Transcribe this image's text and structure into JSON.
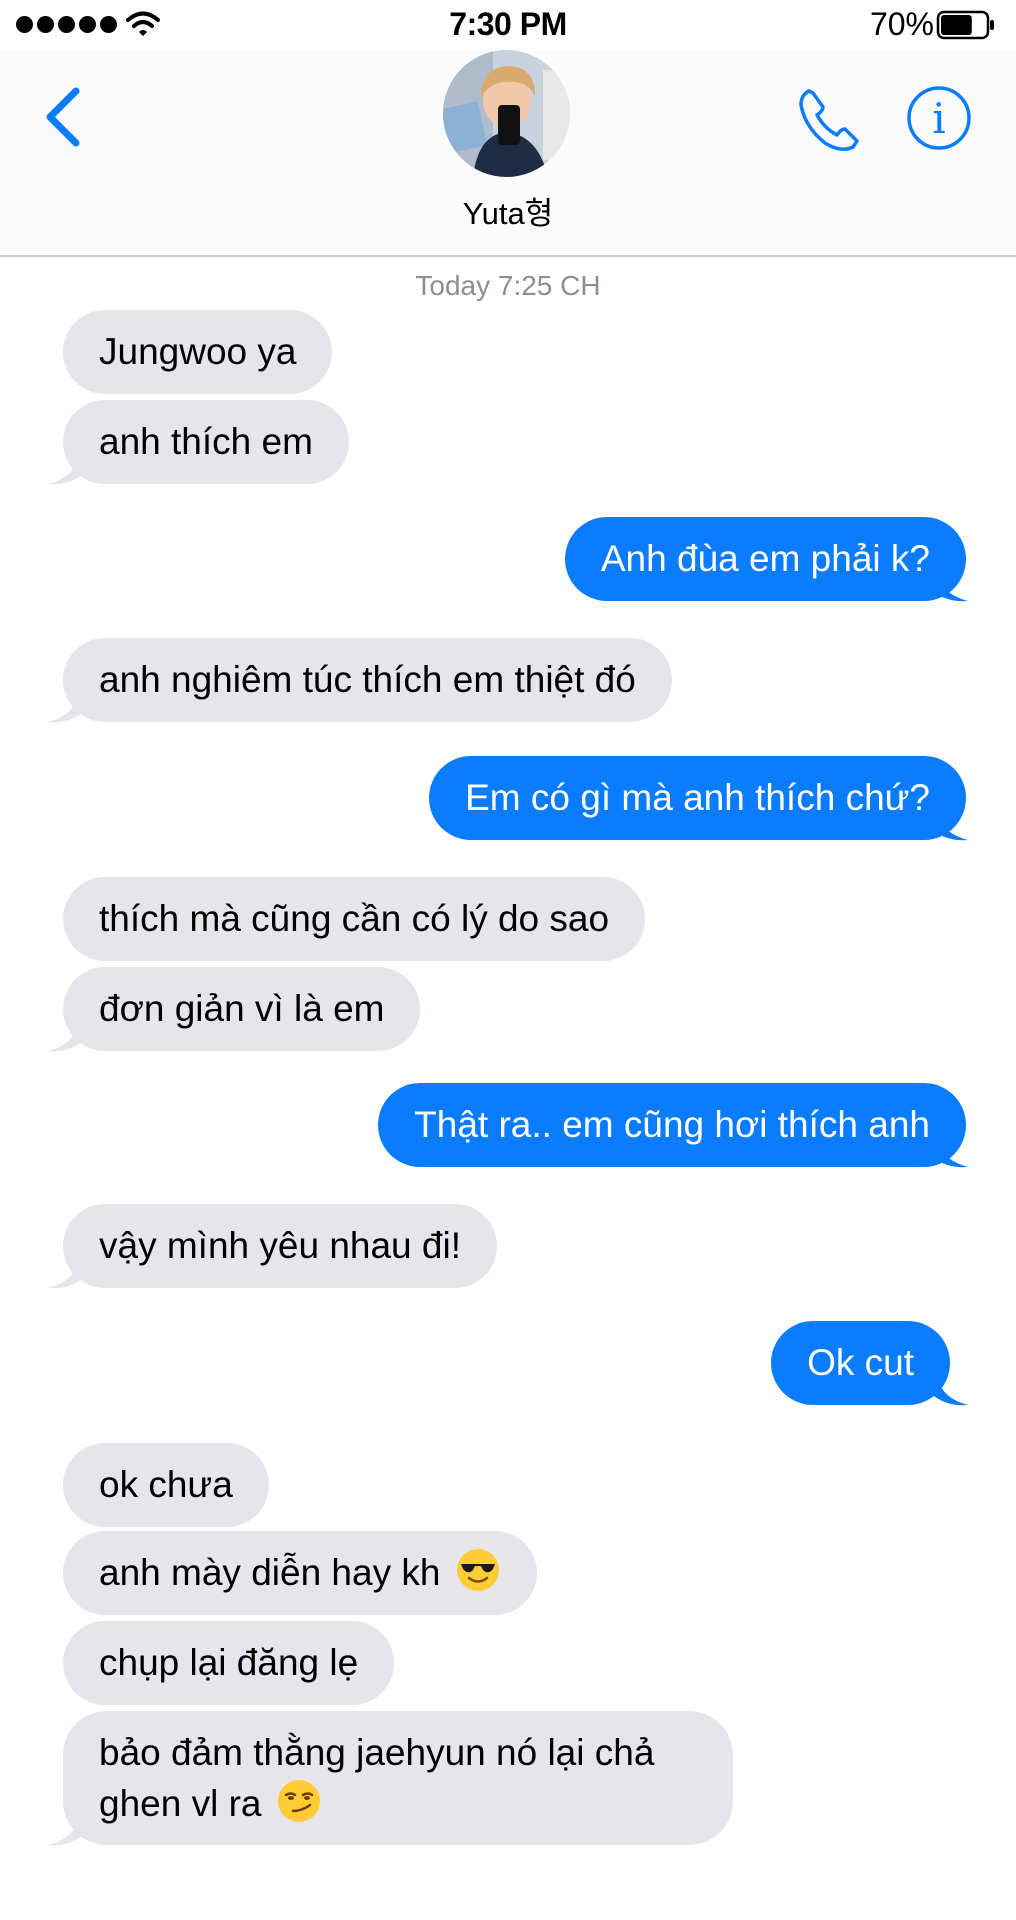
{
  "status_bar": {
    "time": "7:30 PM",
    "battery_percent": "70%",
    "battery_level": 0.7
  },
  "header": {
    "contact_name": "Yuta형"
  },
  "thread": {
    "timestamp": "Today 7:25 CH",
    "messages": [
      {
        "side": "in",
        "text": "Jungwoo ya"
      },
      {
        "side": "in",
        "text": "anh thích em"
      },
      {
        "side": "out",
        "text": "Anh đùa em phải k?"
      },
      {
        "side": "in",
        "text": "anh nghiêm túc thích em thiệt đó"
      },
      {
        "side": "out",
        "text": "Em có gì mà anh thích chứ?"
      },
      {
        "side": "in",
        "text": "thích mà cũng cần có lý do sao"
      },
      {
        "side": "in",
        "text": "đơn giản vì là em"
      },
      {
        "side": "out",
        "text": "Thật ra.. em cũng hơi thích anh"
      },
      {
        "side": "in",
        "text": "vậy mình yêu nhau đi!"
      },
      {
        "side": "out",
        "text": "Ok cut"
      },
      {
        "side": "in",
        "text": "ok chưa"
      },
      {
        "side": "in",
        "text": "anh mày diễn hay kh",
        "emoji": "sunglasses-emoji"
      },
      {
        "side": "in",
        "text": "chụp lại đăng lẹ"
      },
      {
        "side": "in",
        "text": "bảo đảm thằng jaehyun nó lại chả ghen vl ra",
        "emoji": "smirk-emoji"
      }
    ]
  },
  "colors": {
    "accent": "#0a7cff",
    "incoming_bubble": "#e5e5ea",
    "timestamp": "#8e8e93"
  }
}
